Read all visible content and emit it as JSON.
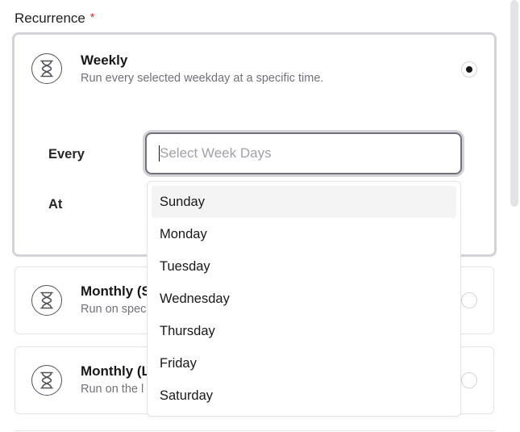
{
  "recurrence": {
    "label": "Recurrence",
    "required_mark": "*"
  },
  "options": [
    {
      "title": "Weekly",
      "description": "Run every selected weekday at a specific time.",
      "selected": true,
      "icon": "hourglass-icon"
    },
    {
      "title": "Monthly (S",
      "description": "Run on spec",
      "selected": false,
      "icon": "hourglass-icon"
    },
    {
      "title": "Monthly (L",
      "description": "Run on the l",
      "selected": false,
      "icon": "hourglass-icon"
    }
  ],
  "weekly_form": {
    "every_label": "Every",
    "at_label": "At",
    "weekdays_placeholder": "Select Week Days"
  },
  "weekday_dropdown": {
    "items": [
      "Sunday",
      "Monday",
      "Tuesday",
      "Wednesday",
      "Thursday",
      "Friday",
      "Saturday"
    ],
    "highlighted": "Sunday"
  },
  "colors": {
    "required": "#d92d20",
    "selected_border": "#d4d4d8",
    "highlight_bg": "#f4f4f5"
  }
}
